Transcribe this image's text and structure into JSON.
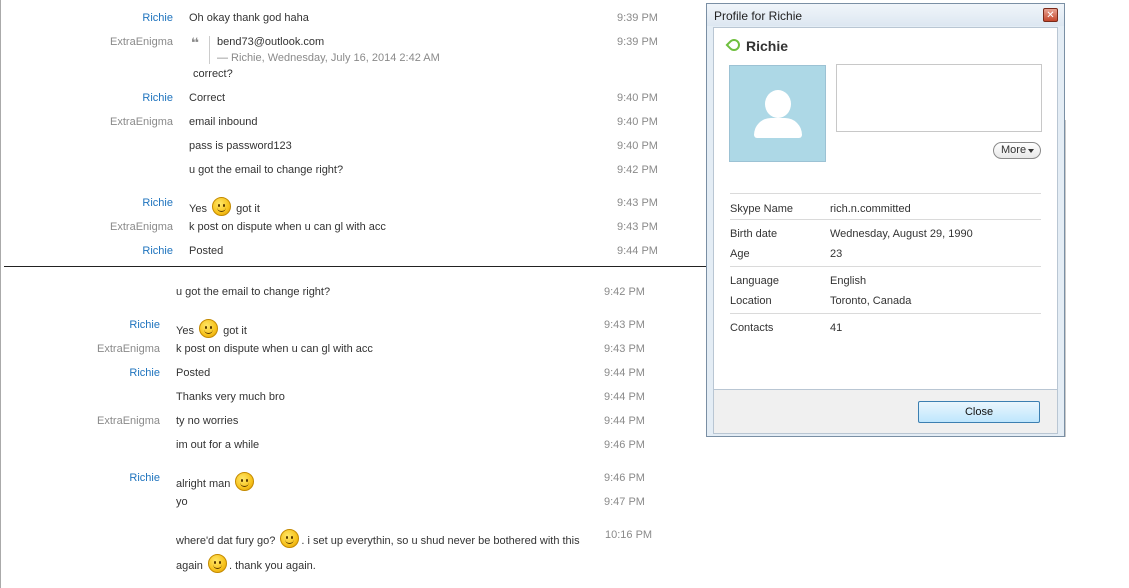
{
  "top_chat": {
    "messages": [
      {
        "sender": "Richie",
        "sender_type": "richie",
        "text": "Oh okay thank god haha",
        "time": "9:39 PM"
      },
      {
        "sender": "ExtraEnigma",
        "sender_type": "extra",
        "quote_text": "bend73@outlook.com",
        "quote_source": "— Richie, Wednesday, July 16, 2014 2:42 AM",
        "text": "correct?",
        "time": "9:39 PM"
      },
      {
        "sender": "Richie",
        "sender_type": "richie",
        "text": "Correct",
        "time": "9:40 PM"
      },
      {
        "sender": "ExtraEnigma",
        "sender_type": "extra",
        "text": "email inbound",
        "time": "9:40 PM"
      },
      {
        "sender": "",
        "text": "pass is password123",
        "time": "9:40 PM"
      },
      {
        "sender": "",
        "text": "u got the email to change right?",
        "time": "9:42 PM"
      },
      {
        "sender": "Richie",
        "sender_type": "richie",
        "text_before": "Yes",
        "text_after": "got it",
        "time": "9:43 PM"
      },
      {
        "sender": "ExtraEnigma",
        "sender_type": "extra",
        "text": "k post on dispute when u can gl with acc",
        "time": "9:43 PM"
      },
      {
        "sender": "Richie",
        "sender_type": "richie",
        "text": "Posted",
        "time": "9:44 PM"
      }
    ]
  },
  "bottom_chat": {
    "messages": [
      {
        "sender": "",
        "text": "u got the email to change right?",
        "time": "9:42 PM"
      },
      {
        "sender": "Richie",
        "text_before": "Yes",
        "text_after": "got it",
        "time": "9:43 PM"
      },
      {
        "sender": "ExtraEnigma",
        "text": "k post on dispute when u can gl with acc",
        "time": "9:43 PM"
      },
      {
        "sender": "Richie",
        "text": "Posted",
        "time": "9:44 PM"
      },
      {
        "sender": "",
        "text": "Thanks very much bro",
        "time": "9:44 PM"
      },
      {
        "sender": "ExtraEnigma",
        "text": "ty no worries",
        "time": "9:44 PM"
      },
      {
        "sender": "",
        "text": "im out for a while",
        "time": "9:46 PM"
      },
      {
        "sender": "Richie",
        "text_before": "alright man",
        "text_after": "",
        "time": "9:46 PM"
      },
      {
        "sender": "",
        "text": "yo",
        "time": "9:47 PM"
      },
      {
        "sender": "",
        "line1_before": "where'd dat fury go?",
        "line1_after": ". i set up everythin, so u shud never be bothered with this",
        "line2_before": "again",
        "line2_after": ". thank you again.",
        "time": "10:16 PM"
      }
    ]
  },
  "profile_dialog": {
    "title": "Profile for Richie",
    "close_x": "✕",
    "name": "Richie",
    "more_label": "More",
    "fields": {
      "skype_name_label": "Skype Name",
      "skype_name": "rich.n.committed",
      "birth_date_label": "Birth date",
      "birth_date": "Wednesday, August 29, 1990",
      "age_label": "Age",
      "age": "23",
      "language_label": "Language",
      "language": "English",
      "location_label": "Location",
      "location": "Toronto, Canada",
      "contacts_label": "Contacts",
      "contacts": "41"
    },
    "close_button": "Close"
  },
  "colors": {
    "sender_richie": "#1e73be",
    "sender_extra": "#8a8a8a",
    "time": "#8a8a8a",
    "online_status": "#6fbf3f"
  }
}
